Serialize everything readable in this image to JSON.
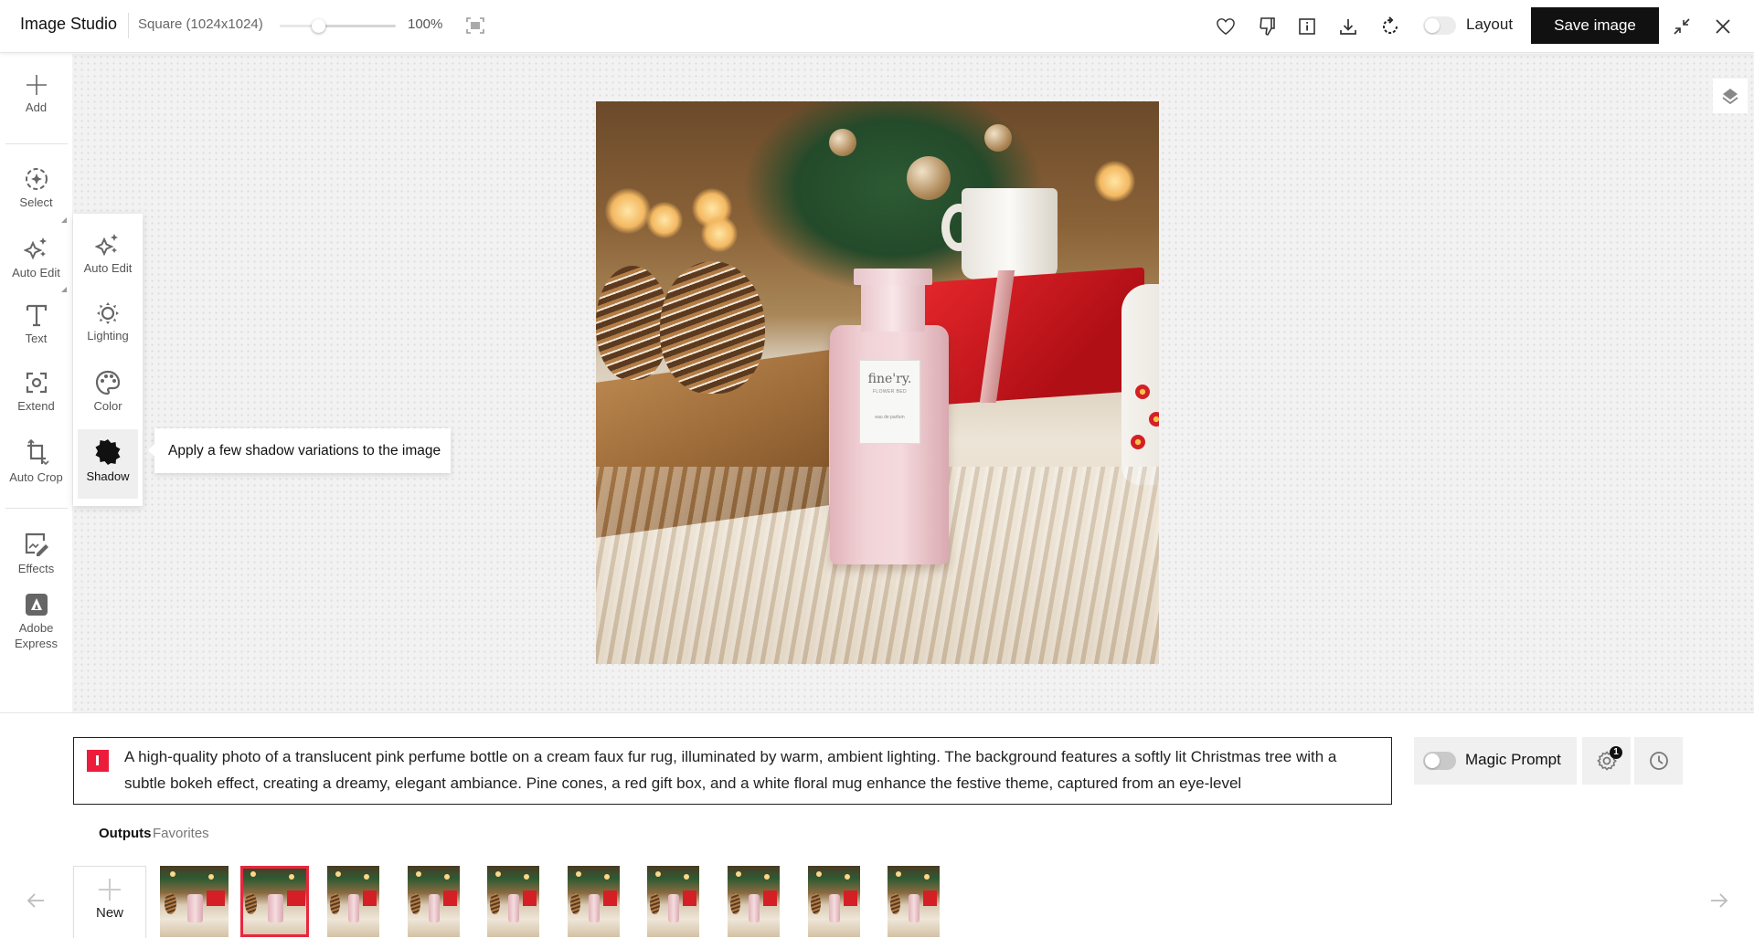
{
  "header": {
    "app_title": "Image Studio",
    "size_label": "Square (1024x1024)",
    "zoom_percent": "100%",
    "zoom_slider_value": 0.33,
    "icons": [
      "heart-icon",
      "thumbs-down-icon",
      "info-icon",
      "download-icon",
      "regenerate-icon"
    ],
    "layout_toggle": {
      "label": "Layout",
      "on": false
    },
    "save_label": "Save image"
  },
  "sidebar": {
    "items": [
      {
        "id": "add",
        "label": "Add",
        "icon": "plus-icon"
      },
      {
        "id": "select",
        "label": "Select",
        "icon": "select-icon"
      },
      {
        "id": "auto-edit",
        "label": "Auto Edit",
        "icon": "sparkle-icon"
      },
      {
        "id": "text",
        "label": "Text",
        "icon": "text-icon"
      },
      {
        "id": "extend",
        "label": "Extend",
        "icon": "extend-icon"
      },
      {
        "id": "auto-crop",
        "label": "Auto Crop",
        "icon": "crop-icon"
      },
      {
        "id": "effects",
        "label": "Effects",
        "icon": "effects-icon"
      },
      {
        "id": "adobe-express",
        "label": "Adobe Express",
        "icon": "adobe-express-icon"
      }
    ]
  },
  "subpanel": {
    "items": [
      {
        "id": "auto-edit",
        "label": "Auto Edit",
        "icon": "sparkle-icon"
      },
      {
        "id": "lighting",
        "label": "Lighting",
        "icon": "lighting-icon"
      },
      {
        "id": "color",
        "label": "Color",
        "icon": "palette-icon"
      },
      {
        "id": "shadow",
        "label": "Shadow",
        "icon": "shadow-icon",
        "active": true
      }
    ],
    "tooltip": "Apply a few shadow variations to the image"
  },
  "canvas": {
    "image_alt": "Pink perfume bottle on cream faux fur rug with Christmas decor",
    "bottle_label": {
      "brand": "fine'ry.",
      "name": "FLOWER BED",
      "type": "eau de parfum"
    }
  },
  "prompt": {
    "text": "A high-quality photo of a translucent pink perfume bottle on a cream faux fur rug, illuminated by warm, ambient lighting. The background features a softly lit Christmas tree with a subtle bokeh effect, creating a dreamy, elegant ambiance. Pine cones, a red gift box, and a white floral mug enhance the festive theme, captured from an eye-level",
    "magic_prompt": {
      "label": "Magic Prompt",
      "on": false
    },
    "settings_badge": "1"
  },
  "gallery": {
    "tabs": [
      {
        "label": "Outputs",
        "active": true
      },
      {
        "label": "Favorites",
        "active": false
      }
    ],
    "new_label": "New",
    "thumbnails": [
      {
        "index": 1,
        "selected": false
      },
      {
        "index": 2,
        "selected": true
      },
      {
        "index": 3,
        "selected": false
      },
      {
        "index": 4,
        "selected": false
      },
      {
        "index": 5,
        "selected": false
      },
      {
        "index": 6,
        "selected": false
      },
      {
        "index": 7,
        "selected": false
      },
      {
        "index": 8,
        "selected": false
      },
      {
        "index": 9,
        "selected": false
      },
      {
        "index": 10,
        "selected": false
      }
    ]
  },
  "colors": {
    "accent_red": "#ee1c3b",
    "selected_outline": "#e8273d",
    "primary_button": "#111111"
  }
}
